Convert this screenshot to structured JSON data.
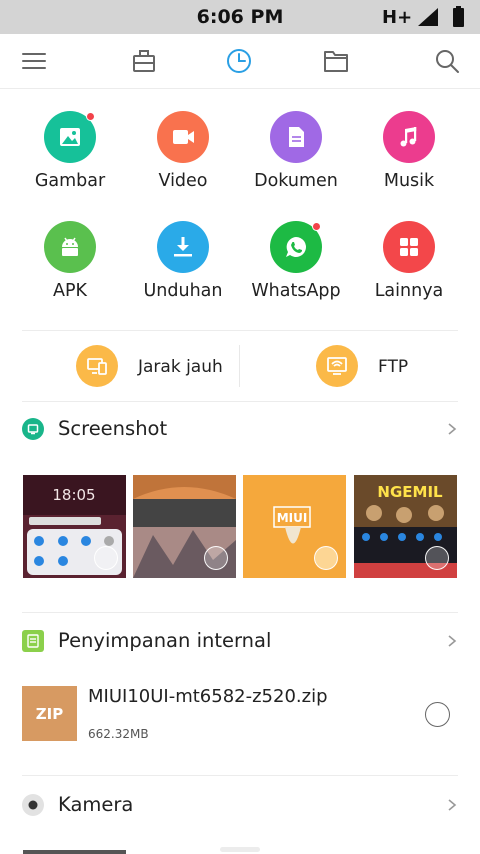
{
  "status": {
    "time": "6:06 PM",
    "network": "H+",
    "icons": [
      "signal-icon",
      "battery-icon"
    ]
  },
  "toolbar": {
    "icons": [
      "menu-icon",
      "toolbox-icon",
      "clock-icon",
      "folder-icon",
      "search-icon"
    ],
    "active": "clock-icon",
    "accent": "#2a9fe4"
  },
  "categories": [
    {
      "label": "Gambar",
      "icon": "image-icon",
      "color": "#16c199",
      "badge": true
    },
    {
      "label": "Video",
      "icon": "video-icon",
      "color": "#f9724e",
      "badge": false
    },
    {
      "label": "Dokumen",
      "icon": "document-icon",
      "color": "#a069e5",
      "badge": false
    },
    {
      "label": "Musik",
      "icon": "music-icon",
      "color": "#ec3c8e",
      "badge": false
    },
    {
      "label": "APK",
      "icon": "android-icon",
      "color": "#5ac04e",
      "badge": false
    },
    {
      "label": "Unduhan",
      "icon": "download-icon",
      "color": "#2aaae8",
      "badge": false
    },
    {
      "label": "WhatsApp",
      "icon": "whatsapp-icon",
      "color": "#1dba44",
      "badge": true
    },
    {
      "label": "Lainnya",
      "icon": "apps-icon",
      "color": "#f3474a",
      "badge": false
    }
  ],
  "remote": {
    "remote_label": "Jarak jauh",
    "ftp_label": "FTP",
    "color": "#fbb948"
  },
  "sections": {
    "screenshot": {
      "title": "Screenshot",
      "icon_color": "#19b58a"
    },
    "internal": {
      "title": "Penyimpanan internal",
      "icon_color": "#8bd04b"
    },
    "camera": {
      "title": "Kamera",
      "icon_color": "#444444"
    }
  },
  "thumbnails": {
    "t1_time": "18:05",
    "t3_text": "MIUI",
    "t4_text": "NGEMIL"
  },
  "file": {
    "type_label": "ZIP",
    "name": "MIUI10UI-mt6582-z520.zip",
    "size": "662.32MB"
  }
}
